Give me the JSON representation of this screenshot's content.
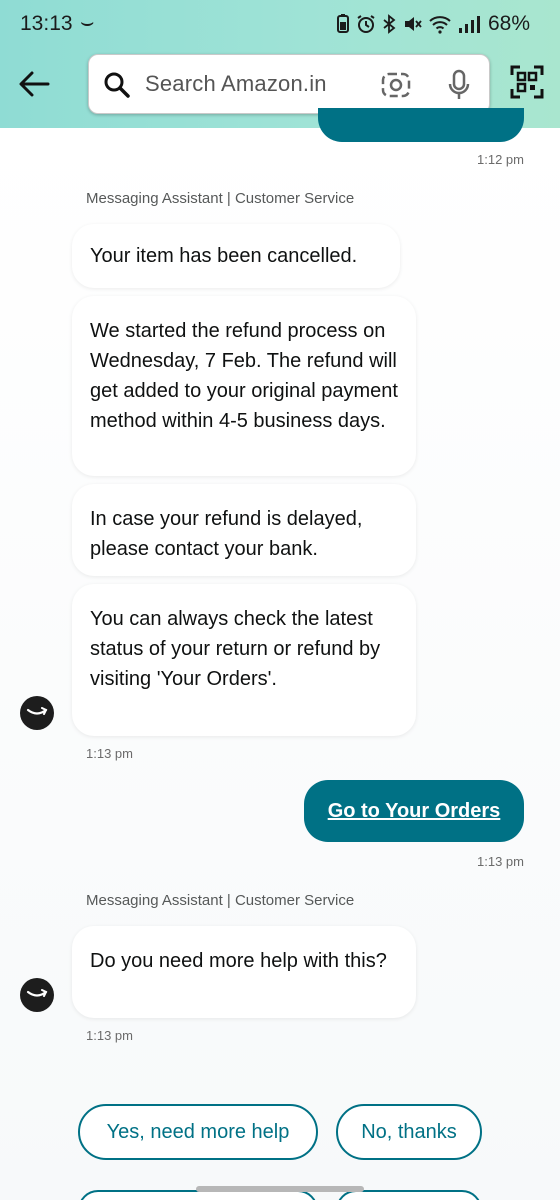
{
  "status_bar": {
    "time": "13:13",
    "battery": "68%"
  },
  "header": {
    "search_placeholder": "Search Amazon.in"
  },
  "messages": [
    {
      "time": "1:12 pm"
    },
    {
      "sender": "Messaging Assistant | Customer Service",
      "bubbles": [
        "Your item has been cancelled.",
        "We started the refund process on Wednesday, 7 Feb. The refund will get added to your original payment method within 4-5 business days.",
        "In case your refund is delayed, please contact your bank.",
        "You can always check the latest status of your return or refund by visiting 'Your Orders'."
      ],
      "time": "1:13 pm"
    },
    {
      "link": "Go to Your Orders",
      "time": "1:13 pm"
    },
    {
      "sender": "Messaging Assistant | Customer Service",
      "bubbles": [
        "Do you need more help with this?"
      ],
      "time": "1:13 pm"
    }
  ],
  "quick_replies": [
    "Yes, need more help",
    "No, thanks"
  ],
  "colors": {
    "accent": "#007185",
    "header_gradient_start": "#8fdcd4",
    "header_gradient_end": "#a9e6cf"
  }
}
